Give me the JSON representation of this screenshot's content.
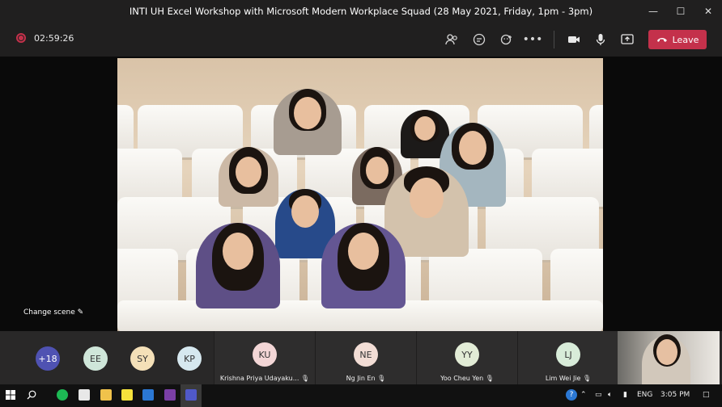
{
  "window": {
    "title": "INTI UH Excel Workshop with Microsoft Modern Workplace Squad (28 May 2021, Friday, 1pm - 3pm)"
  },
  "toolbar": {
    "timer": "02:59:26",
    "leave_label": "Leave"
  },
  "stage": {
    "change_scene_label": "Change scene"
  },
  "participants": {
    "overflow_count": "+18",
    "avatars": [
      {
        "initials": "EE",
        "color": "#cfe6d9"
      },
      {
        "initials": "SY",
        "color": "#f4e0b8"
      },
      {
        "initials": "KP",
        "color": "#d6e8ef"
      }
    ],
    "tiles": [
      {
        "initials": "KU",
        "name": "Krishna Priya Udayaku...",
        "color": "#f3d6d6"
      },
      {
        "initials": "NE",
        "name": "Ng Jin En",
        "color": "#f2ddd5"
      },
      {
        "initials": "YY",
        "name": "Yoo Cheu Yen",
        "color": "#e2ecd6"
      },
      {
        "initials": "LJ",
        "name": "Lim Wei Jie",
        "color": "#d8ecd9"
      }
    ]
  },
  "taskbar": {
    "lang": "ENG",
    "time": "3:05 PM"
  }
}
